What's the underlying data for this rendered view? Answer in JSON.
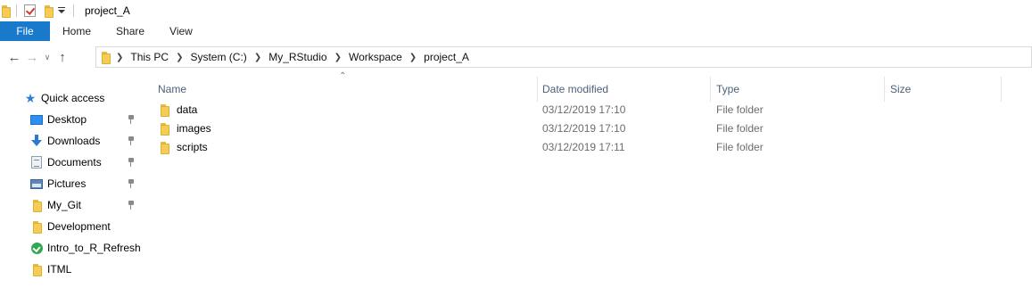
{
  "window": {
    "title": "project_A"
  },
  "ribbon": {
    "tabs": [
      {
        "label": "File"
      },
      {
        "label": "Home"
      },
      {
        "label": "Share"
      },
      {
        "label": "View"
      }
    ]
  },
  "address": {
    "breadcrumbs": [
      "This PC",
      "System (C:)",
      "My_RStudio",
      "Workspace",
      "project_A"
    ]
  },
  "navigation_pane": {
    "items": [
      {
        "label": "Quick access",
        "icon": "quick-access-star-icon",
        "pinned": false
      },
      {
        "label": "Desktop",
        "icon": "desktop-icon",
        "pinned": true
      },
      {
        "label": "Downloads",
        "icon": "downloads-icon",
        "pinned": true
      },
      {
        "label": "Documents",
        "icon": "documents-icon",
        "pinned": true
      },
      {
        "label": "Pictures",
        "icon": "pictures-icon",
        "pinned": true
      },
      {
        "label": "My_Git",
        "icon": "folder-icon",
        "pinned": true
      },
      {
        "label": "Development",
        "icon": "folder-icon",
        "pinned": false
      },
      {
        "label": "Intro_to_R_Refresh",
        "icon": "sync-status-icon",
        "pinned": false
      },
      {
        "label": "ITML",
        "icon": "folder-icon",
        "pinned": false
      }
    ]
  },
  "file_list": {
    "columns": [
      {
        "label": "Name"
      },
      {
        "label": "Date modified"
      },
      {
        "label": "Type"
      },
      {
        "label": "Size"
      }
    ],
    "rows": [
      {
        "name": "data",
        "date_modified": "03/12/2019 17:10",
        "type": "File folder",
        "size": ""
      },
      {
        "name": "images",
        "date_modified": "03/12/2019 17:10",
        "type": "File folder",
        "size": ""
      },
      {
        "name": "scripts",
        "date_modified": "03/12/2019 17:11",
        "type": "File folder",
        "size": ""
      }
    ]
  },
  "colors": {
    "file_tab_bg": "#1979ca",
    "column_header_text": "#4c607a",
    "secondary_text": "#6d6d6d",
    "folder_yellow": "#f5cd55"
  }
}
